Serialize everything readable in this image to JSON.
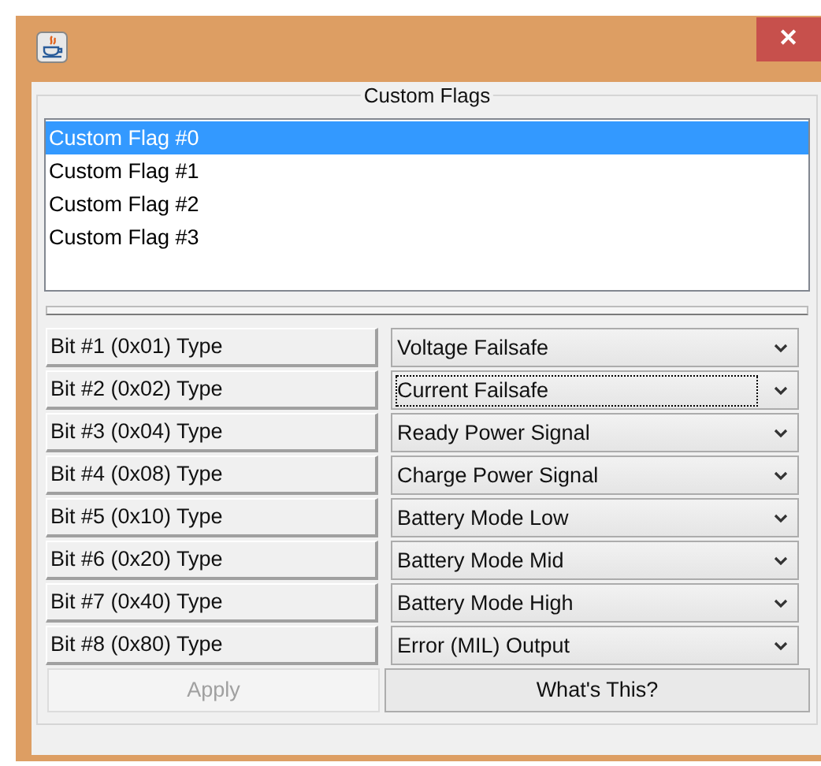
{
  "window": {
    "close": "✕"
  },
  "group": {
    "title": "Custom Flags"
  },
  "list": [
    {
      "label": "Custom Flag #0",
      "selected": true
    },
    {
      "label": "Custom Flag #1",
      "selected": false
    },
    {
      "label": "Custom Flag #2",
      "selected": false
    },
    {
      "label": "Custom Flag #3",
      "selected": false
    }
  ],
  "rows": [
    {
      "label": "Bit #1 (0x01) Type",
      "value": "Voltage Failsafe",
      "focused": false
    },
    {
      "label": "Bit #2 (0x02) Type",
      "value": "Current Failsafe",
      "focused": true
    },
    {
      "label": "Bit #3 (0x04) Type",
      "value": "Ready Power Signal",
      "focused": false
    },
    {
      "label": "Bit #4 (0x08) Type",
      "value": "Charge Power Signal",
      "focused": false
    },
    {
      "label": "Bit #5 (0x10) Type",
      "value": "Battery Mode Low",
      "focused": false
    },
    {
      "label": "Bit #6 (0x20) Type",
      "value": "Battery Mode Mid",
      "focused": false
    },
    {
      "label": "Bit #7 (0x40) Type",
      "value": "Battery Mode High",
      "focused": false
    },
    {
      "label": "Bit #8 (0x80) Type",
      "value": "Error (MIL) Output",
      "focused": false
    }
  ],
  "buttons": [
    {
      "label": "Apply",
      "disabled": true
    },
    {
      "label": "What's This?",
      "disabled": false
    }
  ]
}
